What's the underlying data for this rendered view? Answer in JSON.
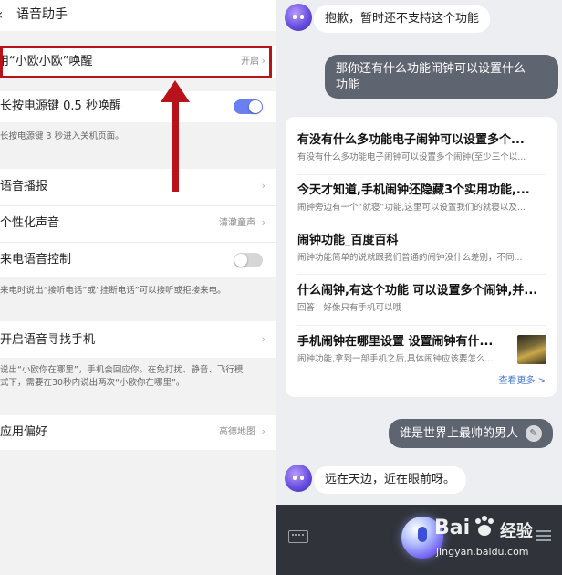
{
  "left": {
    "title": "语音助手",
    "rows": [
      {
        "label": "用“小欧小欧”唤醒",
        "value": "开启"
      },
      {
        "label": "长按电源键 0.5 秒唤醒",
        "desc": "长按电源键 3 秒进入关机页面。",
        "toggle_on": true
      },
      {
        "label": "语音播报"
      },
      {
        "label": "个性化声音",
        "value": "清澈童声"
      },
      {
        "label": "来电语音控制",
        "desc": "来电时说出“接听电话”或“挂断电话”可以接听或拒接来电。",
        "toggle_on": false
      },
      {
        "label": "开启语音寻找手机",
        "desc_line1": "说出“小欧你在哪里”，手机会回应你。在免打扰、静音、飞行模",
        "desc_line2": "式下，需要在30秒内说出两次“小欧你在哪里”。"
      },
      {
        "label": "应用偏好",
        "value": "高德地图"
      }
    ],
    "chevron": "›",
    "back_glyph": "‹"
  },
  "chat": {
    "bot_msg_1": "抱歉，暂时还不支持这个功能",
    "user_msg_1_line1": "那你还有什么功能闹钟可以设置什么",
    "user_msg_1_line2": "功能",
    "results": [
      {
        "title": "有没有什么多功能电子闹钟可以设置多个...",
        "snippet": "有没有什么多功能电子闹钟可以设置多个闹钟(至少三个以..."
      },
      {
        "title": "今天才知道,手机闹钟还隐藏3个实用功能,...",
        "snippet": "闹钟旁边有一个“就寝”功能,这里可以设置我们的就寝以及..."
      },
      {
        "title": "闹钟功能_百度百科",
        "snippet": "闹钟功能简单的说就跟我们普通的闹钟没什么差别，不同..."
      },
      {
        "title": "什么闹钟,有这个功能 可以设置多个闹钟,并...",
        "snippet": "回答：好像只有手机可以哦"
      },
      {
        "title": "手机闹钟在哪里设置 设置闹钟有什...",
        "snippet": "闹钟功能,拿到一部手机之后,具体闹钟应该要怎么..."
      }
    ],
    "more_label": "查看更多 >",
    "user_msg_2": "谁是世界上最帅的男人",
    "bot_msg_2": "远在天边，近在眼前呀。"
  },
  "watermark": {
    "line1": "Bai",
    "line2": "经验",
    "line3": "jingyan.baidu.com"
  },
  "colors": {
    "highlight": "#b8121a",
    "toggle_on": "#6a7ff0",
    "user_bubble": "#5f6570",
    "link": "#4a78d0"
  }
}
